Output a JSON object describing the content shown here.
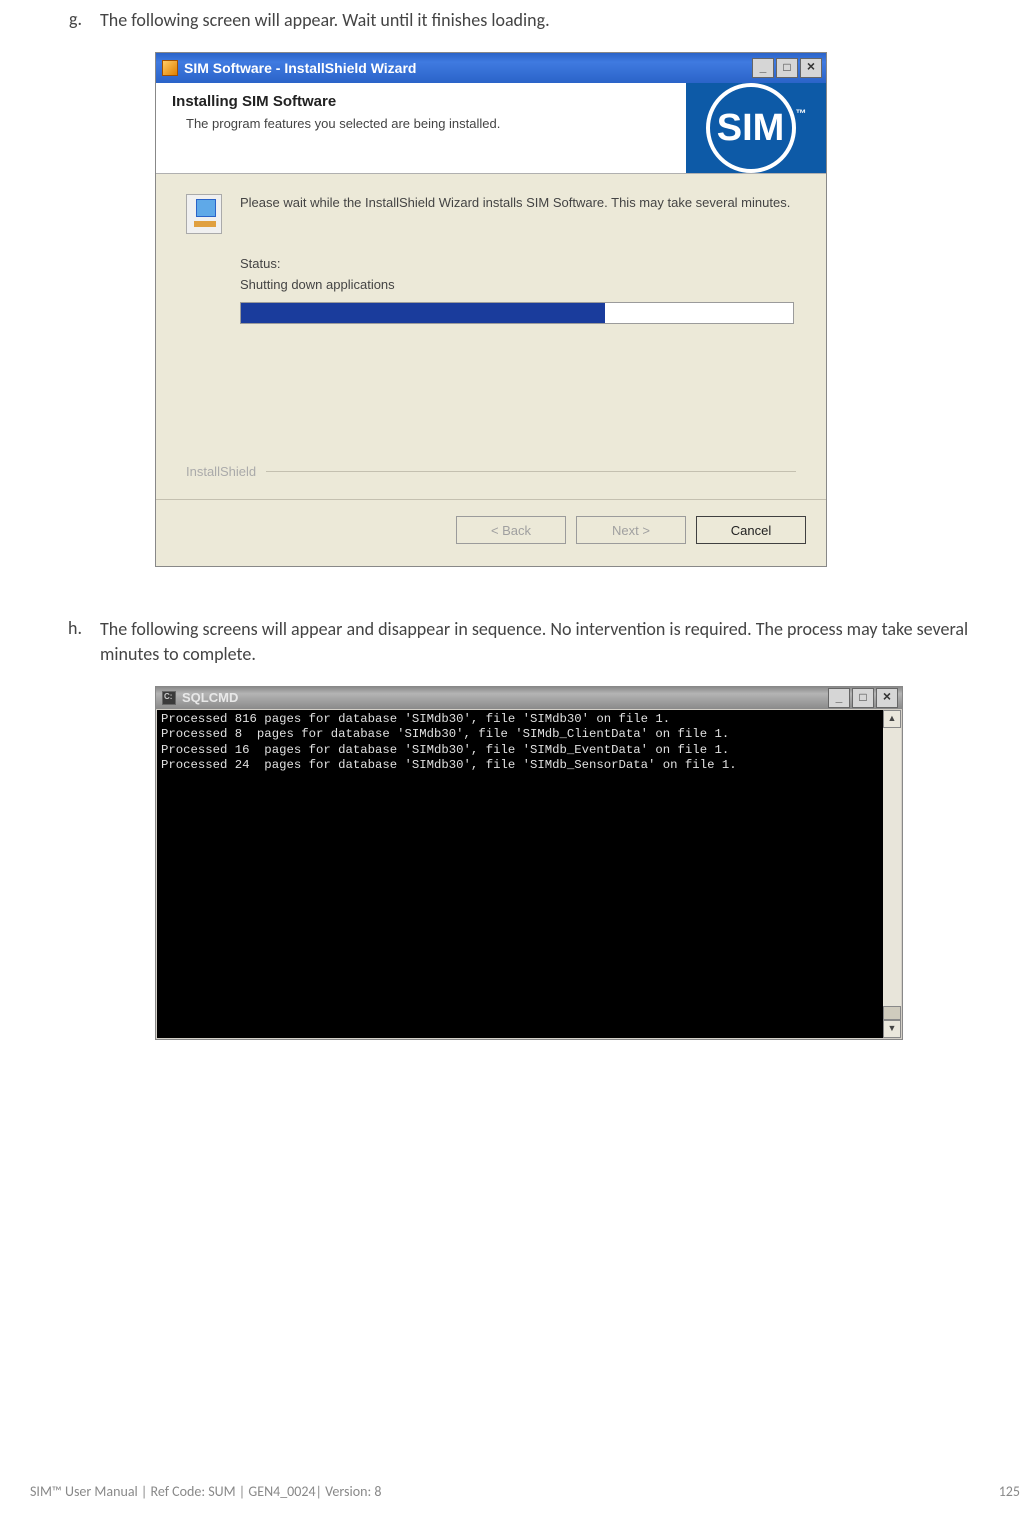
{
  "steps": {
    "g": {
      "letter": "g.",
      "text": "The following screen will appear. Wait until it finishes loading."
    },
    "h": {
      "letter": "h.",
      "text": "The following screens will appear and disappear in sequence. No intervention is required. The process may take several minutes to complete."
    }
  },
  "installer": {
    "window_title": "SIM Software - InstallShield Wizard",
    "banner_title": "Installing SIM Software",
    "banner_sub": "The program features you selected are being installed.",
    "logo_text": "SIM",
    "logo_tm": "™",
    "wait_text": "Please wait while the InstallShield Wizard installs SIM Software. This may take several minutes.",
    "status_label": "Status:",
    "status_msg": "Shutting down applications",
    "progress_pct": 66,
    "brand": "InstallShield",
    "buttons": {
      "back": "< Back",
      "next": "Next >",
      "cancel": "Cancel"
    }
  },
  "console": {
    "window_title": "SQLCMD",
    "lines": [
      "Processed 816 pages for database 'SIMdb30', file 'SIMdb30' on file 1.",
      "Processed 8  pages for database 'SIMdb30', file 'SIMdb_ClientData' on file 1.",
      "Processed 16  pages for database 'SIMdb30', file 'SIMdb_EventData' on file 1.",
      "Processed 24  pages for database 'SIMdb30', file 'SIMdb_SensorData' on file 1."
    ]
  },
  "footer": {
    "left": "SIM™ User Manual | Ref Code: SUM | GEN4_0024| Version: 8",
    "right": "125"
  }
}
